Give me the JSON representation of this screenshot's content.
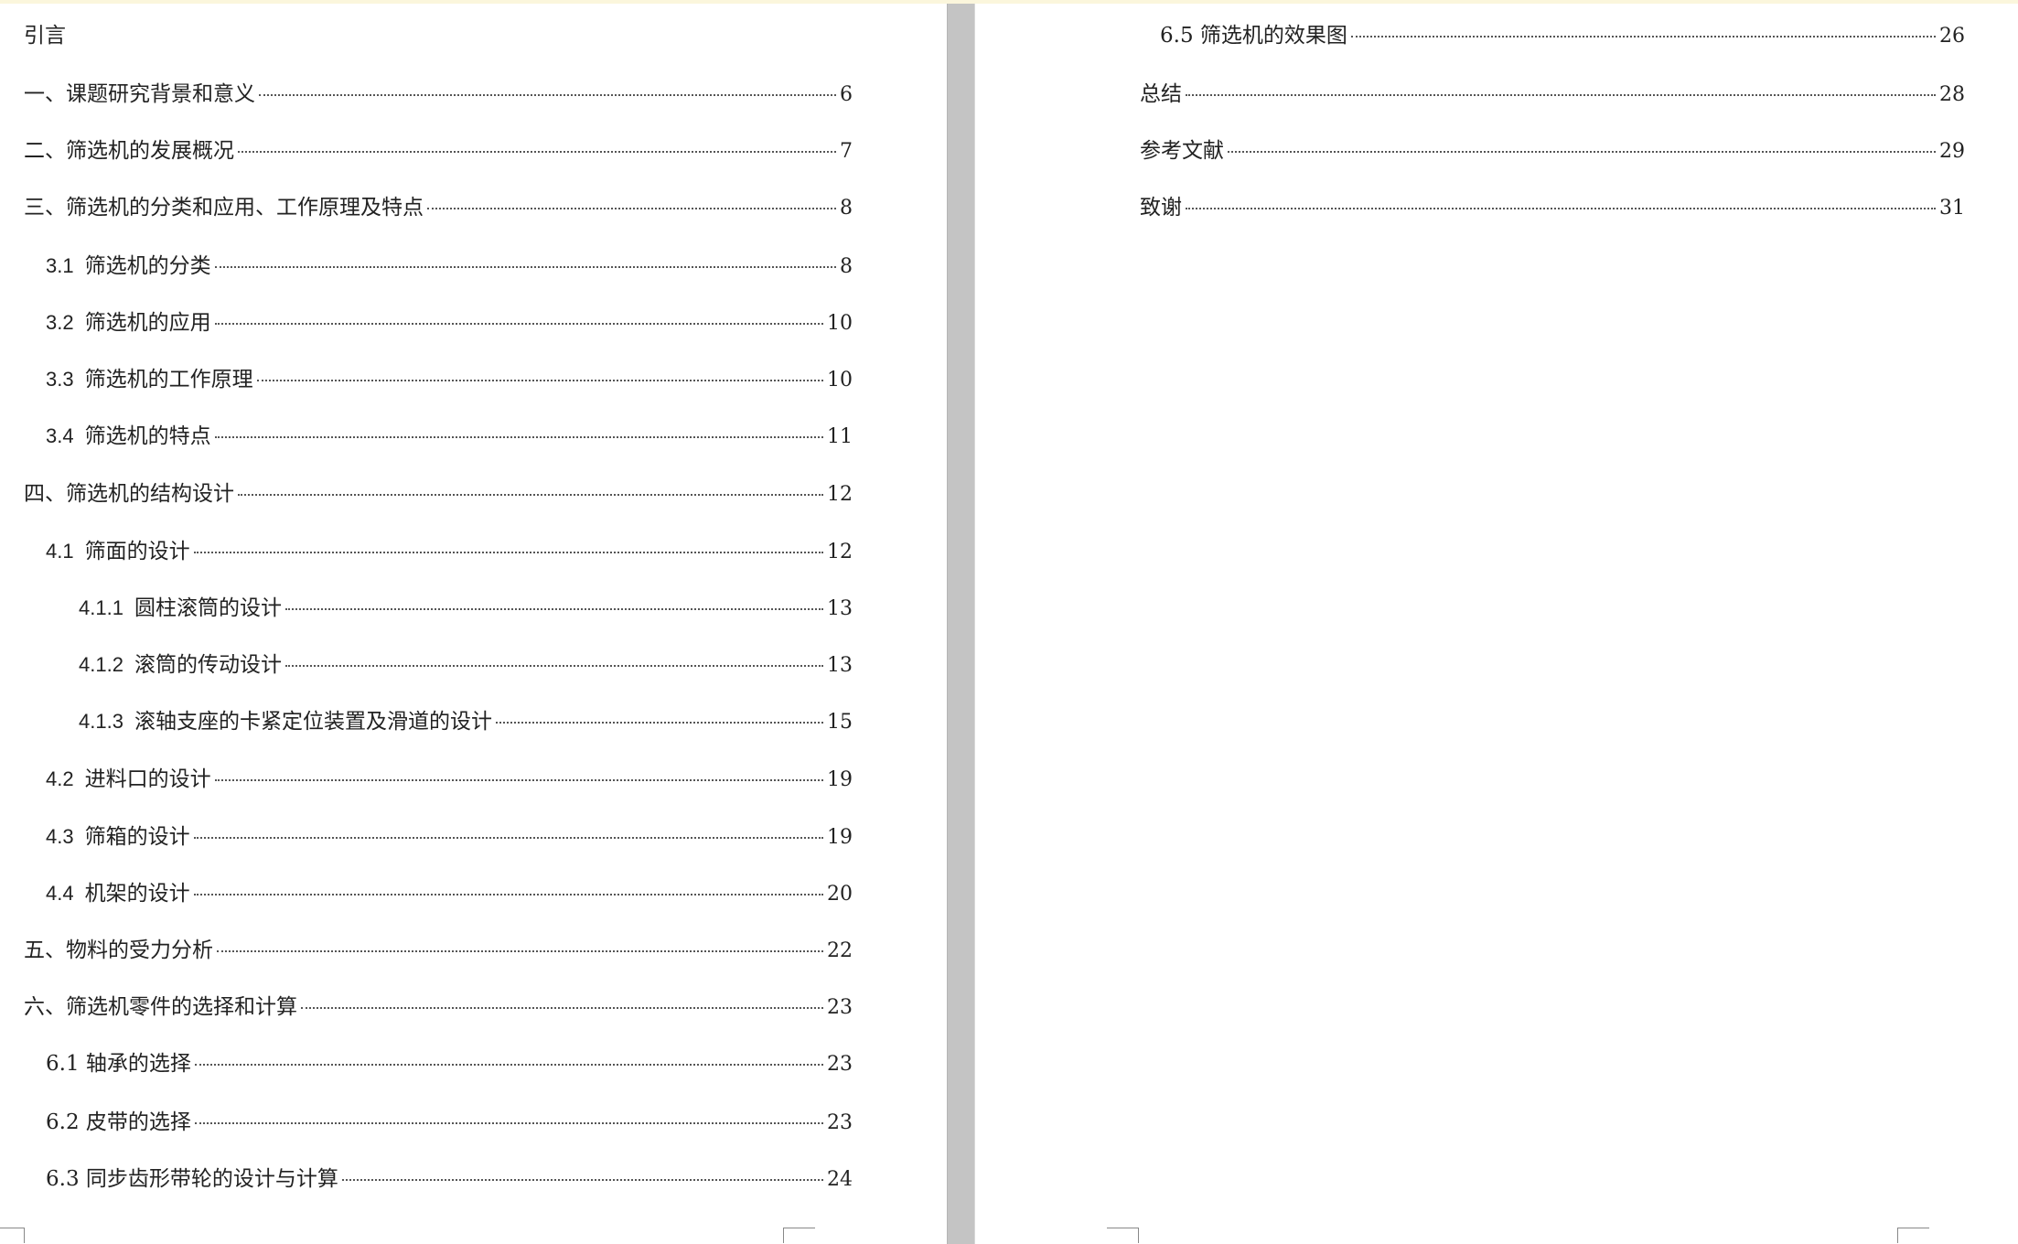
{
  "left_page": {
    "intro_heading": "引言",
    "entries": [
      {
        "num": "",
        "title": "一、课题研究背景和意义",
        "page": "6"
      },
      {
        "num": "",
        "title": "二、筛选机的发展概况",
        "page": "7"
      },
      {
        "num": "",
        "title": "三、筛选机的分类和应用、工作原理及特点",
        "page": "8"
      },
      {
        "num": "3.1",
        "title": "筛选机的分类",
        "page": "8"
      },
      {
        "num": "3.2",
        "title": "筛选机的应用",
        "page": "10"
      },
      {
        "num": "3.3",
        "title": "筛选机的工作原理",
        "page": "10"
      },
      {
        "num": "3.4",
        "title": "筛选机的特点",
        "page": "11"
      },
      {
        "num": "",
        "title": "四、筛选机的结构设计",
        "page": "12"
      },
      {
        "num": "4.1",
        "title": "筛面的设计",
        "page": "12"
      },
      {
        "num": "4.1.1",
        "title": "圆柱滚筒的设计",
        "page": "13"
      },
      {
        "num": "4.1.2",
        "title": "滚筒的传动设计",
        "page": "13"
      },
      {
        "num": "4.1.3",
        "title": "滚轴支座的卡紧定位装置及滑道的设计",
        "page": "15"
      },
      {
        "num": "4.2",
        "title": "进料口的设计",
        "page": "19"
      },
      {
        "num": "4.3",
        "title": "筛箱的设计",
        "page": "19"
      },
      {
        "num": "4.4",
        "title": "机架的设计",
        "page": "20"
      },
      {
        "num": "",
        "title": "五、物料的受力分析",
        "page": "22"
      },
      {
        "num": "",
        "title": "六、筛选机零件的选择和计算",
        "page": "23"
      },
      {
        "num": "",
        "title": "6.1 轴承的选择",
        "page": "23"
      },
      {
        "num": "",
        "title": "6.2 皮带的选择",
        "page": "23"
      },
      {
        "num": "",
        "title": "6.3 同步齿形带轮的设计与计算",
        "page": "24"
      }
    ]
  },
  "right_page": {
    "entries": [
      {
        "num": "",
        "title": "6.5 筛选机的效果图",
        "page": "26"
      },
      {
        "num": "",
        "title": "总结",
        "page": "28"
      },
      {
        "num": "",
        "title": "参考文献",
        "page": "29"
      },
      {
        "num": "",
        "title": "致谢",
        "page": "31"
      }
    ]
  }
}
